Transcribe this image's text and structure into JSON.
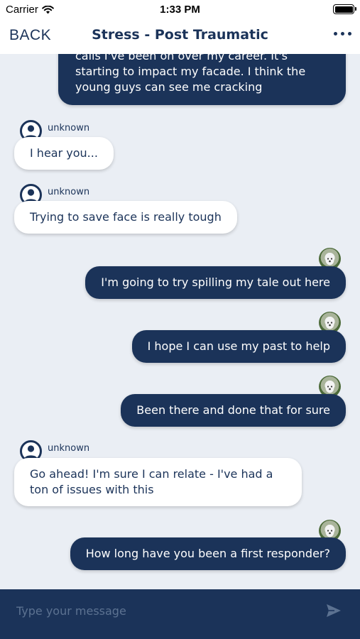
{
  "status_bar": {
    "carrier": "Carrier",
    "time": "1:33 PM"
  },
  "nav": {
    "back_label": "BACK",
    "title": "Stress - Post Traumatic",
    "more_icon": "ellipsis-icon"
  },
  "messages": [
    {
      "direction": "outgoing",
      "text": "calls I've been on over my career. It's starting to impact my facade. I think the young guys can see me cracking",
      "partially_scrolled": true
    },
    {
      "direction": "incoming",
      "sender": "unknown",
      "text": "I hear you..."
    },
    {
      "direction": "incoming",
      "sender": "unknown",
      "text": "Trying to save face is really tough"
    },
    {
      "direction": "outgoing",
      "text": "I'm going to try spilling my tale out here"
    },
    {
      "direction": "outgoing",
      "text": "I hope I can use my past to help"
    },
    {
      "direction": "outgoing",
      "text": "Been there and done that for sure"
    },
    {
      "direction": "incoming",
      "sender": "unknown",
      "text": "Go ahead! I'm sure I can relate - I've had a ton of issues with this"
    },
    {
      "direction": "outgoing",
      "text": "How long have you been a first responder?"
    }
  ],
  "composer": {
    "placeholder": "Type your message",
    "send_icon": "send-icon"
  },
  "colors": {
    "primary": "#1b3359",
    "background": "#eaeef4",
    "incoming_bubble": "#ffffff"
  }
}
